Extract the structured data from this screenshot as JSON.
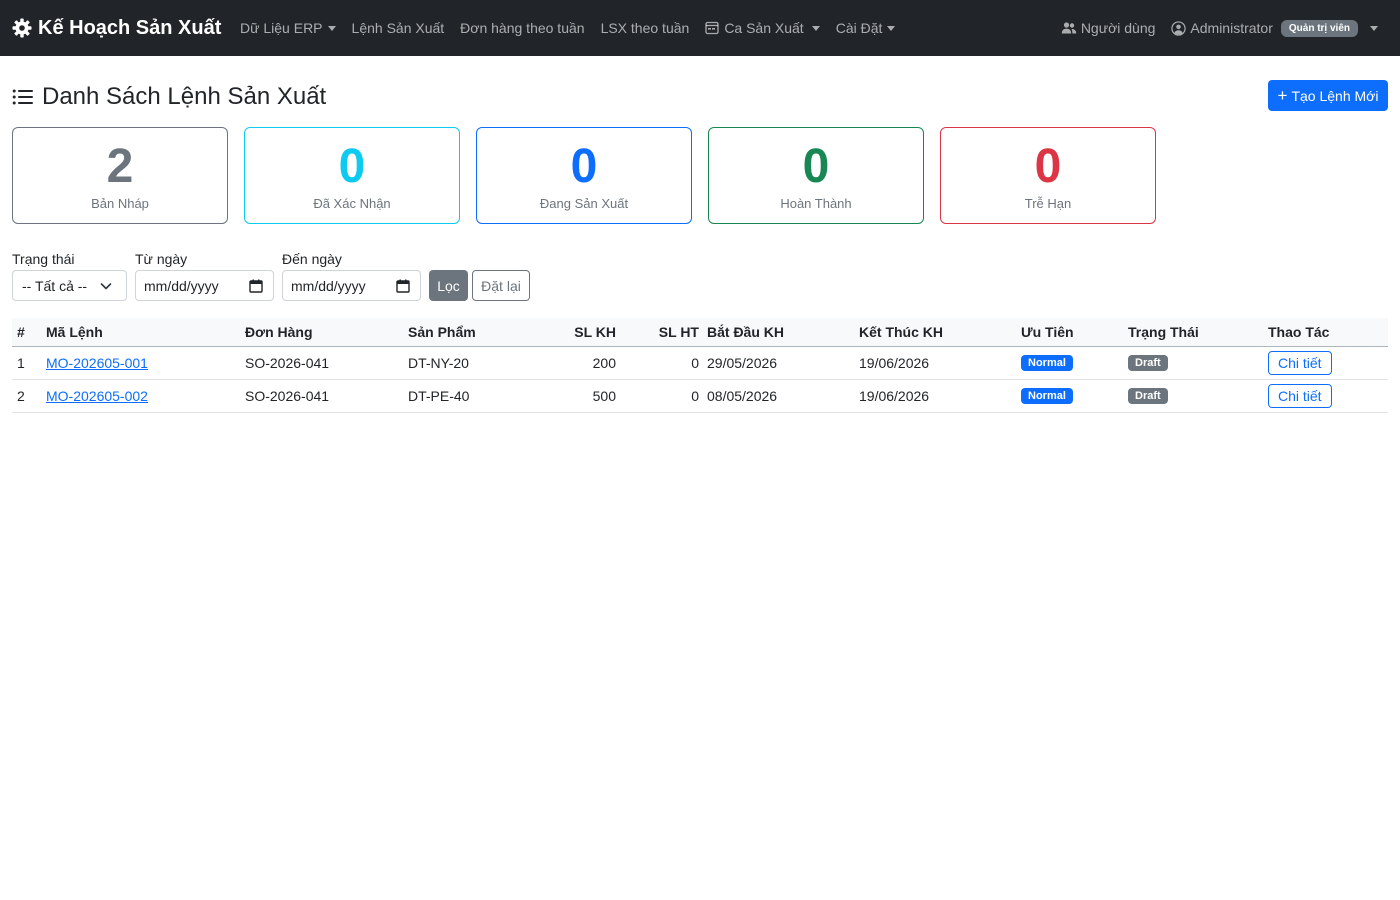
{
  "navbar": {
    "brand": "Kế Hoạch Sản Xuất",
    "items": [
      {
        "label": "Dữ Liệu ERP",
        "dropdown": true
      },
      {
        "label": "Lệnh Sản Xuất",
        "dropdown": false
      },
      {
        "label": "Đơn hàng theo tuần",
        "dropdown": false
      },
      {
        "label": "LSX theo tuần",
        "dropdown": false
      },
      {
        "label": "Ca Sản Xuất",
        "dropdown": true
      },
      {
        "label": "Cài Đặt",
        "dropdown": true
      }
    ],
    "users_label": "Người dùng",
    "account_label": "Administrator",
    "role_badge": "Quản trị viên"
  },
  "page": {
    "title": "Danh Sách Lệnh Sản Xuất",
    "create_button": "Tạo Lệnh Mới"
  },
  "stats": [
    {
      "value": "2",
      "label": "Bản Nháp",
      "color": "#6c757d",
      "border": "#6c757d"
    },
    {
      "value": "0",
      "label": "Đã Xác Nhận",
      "color": "#0dcaf0",
      "border": "#0dcaf0"
    },
    {
      "value": "0",
      "label": "Đang Sản Xuất",
      "color": "#0d6efd",
      "border": "#0d6efd"
    },
    {
      "value": "0",
      "label": "Hoàn Thành",
      "color": "#198754",
      "border": "#198754"
    },
    {
      "value": "0",
      "label": "Trễ Hạn",
      "color": "#dc3545",
      "border": "#dc3545"
    }
  ],
  "filters": {
    "status_label": "Trạng thái",
    "status_value": "-- Tất cả --",
    "from_label": "Từ ngày",
    "from_placeholder": "mm/dd/yyyy",
    "to_label": "Đến ngày",
    "to_placeholder": "mm/dd/yyyy",
    "filter_button": "Lọc",
    "reset_button": "Đặt lại"
  },
  "table": {
    "headers": {
      "idx": "#",
      "code": "Mã Lệnh",
      "order": "Đơn Hàng",
      "product": "Sản Phẩm",
      "qty_plan": "SL KH",
      "qty_done": "SL HT",
      "start": "Bắt Đầu KH",
      "end": "Kết Thúc KH",
      "priority": "Ưu Tiên",
      "status": "Trạng Thái",
      "action": "Thao Tác"
    },
    "rows": [
      {
        "idx": "1",
        "code": "MO-202605-001",
        "order": "SO-2026-041",
        "product": "DT-NY-20",
        "qty_plan": "200",
        "qty_done": "0",
        "start": "29/05/2026",
        "end": "19/06/2026",
        "priority": "Normal",
        "status": "Draft",
        "action": "Chi tiết"
      },
      {
        "idx": "2",
        "code": "MO-202605-002",
        "order": "SO-2026-041",
        "product": "DT-PE-40",
        "qty_plan": "500",
        "qty_done": "0",
        "start": "08/05/2026",
        "end": "19/06/2026",
        "priority": "Normal",
        "status": "Draft",
        "action": "Chi tiết"
      }
    ]
  }
}
